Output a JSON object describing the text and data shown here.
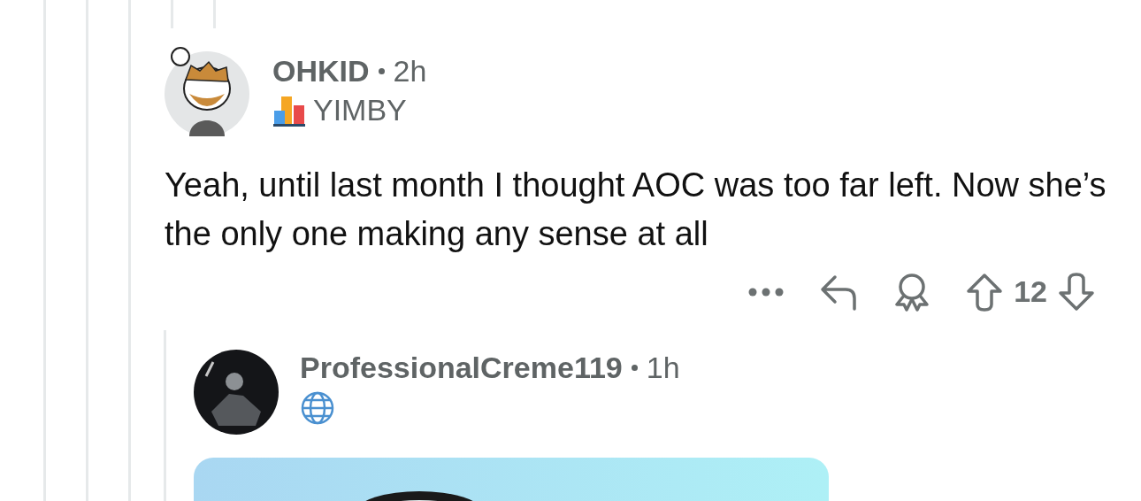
{
  "comment": {
    "author": "OHKID",
    "time": "2h",
    "flair": "YIMBY",
    "body": "Yeah, until last month I thought AOC was too far left. Now she’s the only one making any sense at all",
    "score": "12"
  },
  "reply": {
    "author": "ProfessionalCreme119",
    "time": "1h"
  }
}
